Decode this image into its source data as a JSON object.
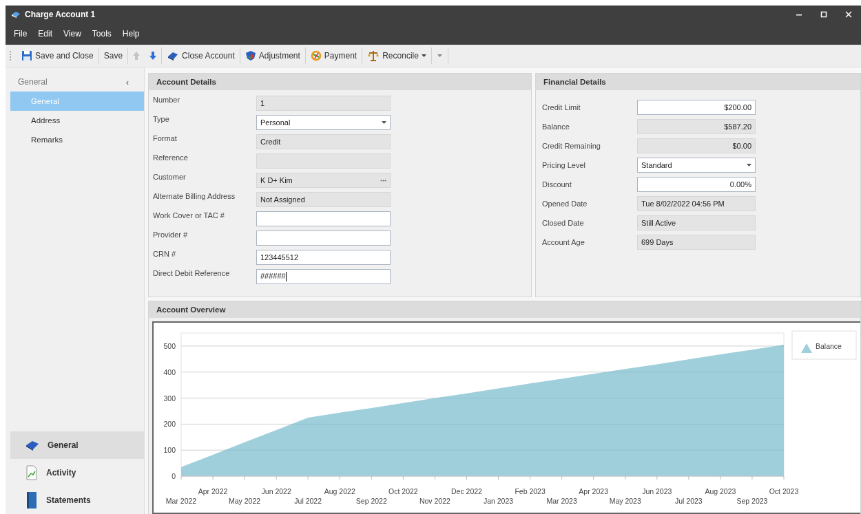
{
  "window": {
    "title": "Charge Account 1"
  },
  "menu": [
    "File",
    "Edit",
    "View",
    "Tools",
    "Help"
  ],
  "toolbar": {
    "items": [
      {
        "kind": "button",
        "label": "Save and Close"
      },
      {
        "kind": "button",
        "label": "Save"
      },
      {
        "kind": "arrow-up",
        "disabled": true
      },
      {
        "kind": "arrow-down",
        "disabled": false
      },
      {
        "kind": "button",
        "label": "Close Account"
      },
      {
        "kind": "button",
        "label": "Adjustment"
      },
      {
        "kind": "button",
        "label": "Payment"
      },
      {
        "kind": "dropdown",
        "label": "Reconcile"
      },
      {
        "kind": "overflow"
      }
    ]
  },
  "sidebar": {
    "header": "General",
    "collapse": "‹",
    "items": [
      {
        "label": "General",
        "selected": true
      },
      {
        "label": "Address",
        "selected": false
      },
      {
        "label": "Remarks",
        "selected": false
      }
    ],
    "nav": [
      {
        "label": "General",
        "selected": true
      },
      {
        "label": "Activity",
        "selected": false
      },
      {
        "label": "Statements",
        "selected": false
      }
    ]
  },
  "account_details": {
    "title": "Account Details",
    "fields": [
      {
        "label": "Number",
        "kind": "text",
        "value": "1",
        "readonly": true
      },
      {
        "label": "Type",
        "kind": "dropdown",
        "value": "Personal",
        "readonly": false
      },
      {
        "label": "Format",
        "kind": "text",
        "value": "Credit",
        "readonly": true
      },
      {
        "label": "Reference",
        "kind": "text",
        "readonly": true
      },
      {
        "label": "Customer",
        "kind": "lookup",
        "value": "K D+ Kim",
        "readonly": true
      },
      {
        "label": "Alternate Billing Address",
        "kind": "text",
        "value": "Not Assigned",
        "readonly": true
      },
      {
        "label": "Work Cover or TAC #",
        "kind": "text",
        "readonly": false
      },
      {
        "label": "Provider #",
        "kind": "text",
        "readonly": false
      },
      {
        "label": "CRN #",
        "kind": "text",
        "value": "123445512",
        "readonly": false
      },
      {
        "label": "Direct Debit Reference",
        "kind": "text",
        "value": "######",
        "readonly": false,
        "focused": true
      }
    ]
  },
  "financial_details": {
    "title": "Financial Details",
    "fields": [
      {
        "label": "Credit Limit",
        "kind": "amount",
        "value": "$200.00",
        "readonly": false
      },
      {
        "label": "Balance",
        "kind": "amount",
        "value": "$587.20",
        "readonly": true
      },
      {
        "label": "Credit Remaining",
        "kind": "amount",
        "value": "$0.00",
        "readonly": true
      },
      {
        "label": "Pricing Level",
        "kind": "dropdown",
        "value": "Standard",
        "readonly": false
      },
      {
        "label": "Discount",
        "kind": "amount",
        "value": "0.00%",
        "readonly": false
      },
      {
        "label": "Opened Date",
        "kind": "text",
        "value": "Tue 8/02/2022 04:56 PM",
        "readonly": true
      },
      {
        "label": "Closed Date",
        "kind": "text",
        "value": "Still Active",
        "readonly": true
      },
      {
        "label": "Account Age",
        "kind": "text",
        "value": "699 Days",
        "readonly": true
      }
    ]
  },
  "account_overview": {
    "title": "Account Overview",
    "chart_data": {
      "type": "area",
      "categories": [
        "Mar 2022",
        "Apr 2022",
        "May 2022",
        "Jun 2022",
        "Jul 2022",
        "Aug 2022",
        "Sep 2022",
        "Oct 2022",
        "Nov 2022",
        "Dec 2022",
        "Jan 2023",
        "Feb 2023",
        "Mar 2023",
        "Apr 2023",
        "May 2023",
        "Jun 2023",
        "Jul 2023",
        "Aug 2023",
        "Sep 2023",
        "Oct 2023"
      ],
      "series": [
        {
          "name": "Balance",
          "color": "#9ecfdb",
          "values": [
            35,
            82,
            130,
            177,
            225,
            244,
            262,
            281,
            300,
            318,
            337,
            356,
            374,
            393,
            412,
            430,
            449,
            468,
            486,
            505
          ]
        }
      ],
      "ylim": [
        0,
        550
      ],
      "grid": true,
      "yticks": [
        0,
        100,
        200,
        300,
        400,
        500
      ]
    }
  }
}
